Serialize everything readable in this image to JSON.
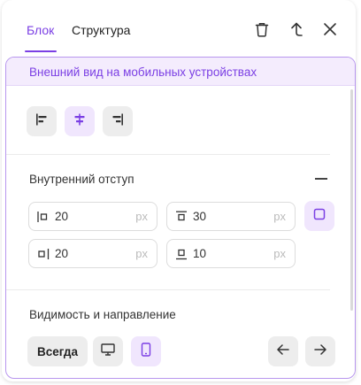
{
  "tabs": [
    {
      "label": "Блок",
      "active": true
    },
    {
      "label": "Структура",
      "active": false
    }
  ],
  "header_icons": [
    "trash-icon",
    "arrow-up-icon",
    "close-icon"
  ],
  "banner": "Внешний вид на мобильных устройствах",
  "alignment": {
    "buttons": [
      "align-left-icon",
      "align-center-icon",
      "align-right-icon"
    ],
    "selected": "align-center-icon"
  },
  "padding": {
    "title": "Внутренний отступ",
    "fields": [
      {
        "side": "left",
        "icon": "padding-left-icon",
        "value": "20",
        "unit": "px"
      },
      {
        "side": "top",
        "icon": "padding-top-icon",
        "value": "30",
        "unit": "px"
      },
      {
        "side": "right",
        "icon": "padding-right-icon",
        "value": "20",
        "unit": "px"
      },
      {
        "side": "bottom",
        "icon": "padding-bottom-icon",
        "value": "10",
        "unit": "px"
      }
    ]
  },
  "visibility": {
    "title": "Видимость и направление",
    "always_label": "Всегда",
    "selected": "mobile-icon"
  },
  "colors": {
    "accent": "#7b3fe4",
    "selected_bg": "#f0e6fd",
    "button_bg": "#ededed",
    "banner_bg": "#f4ecfd"
  }
}
